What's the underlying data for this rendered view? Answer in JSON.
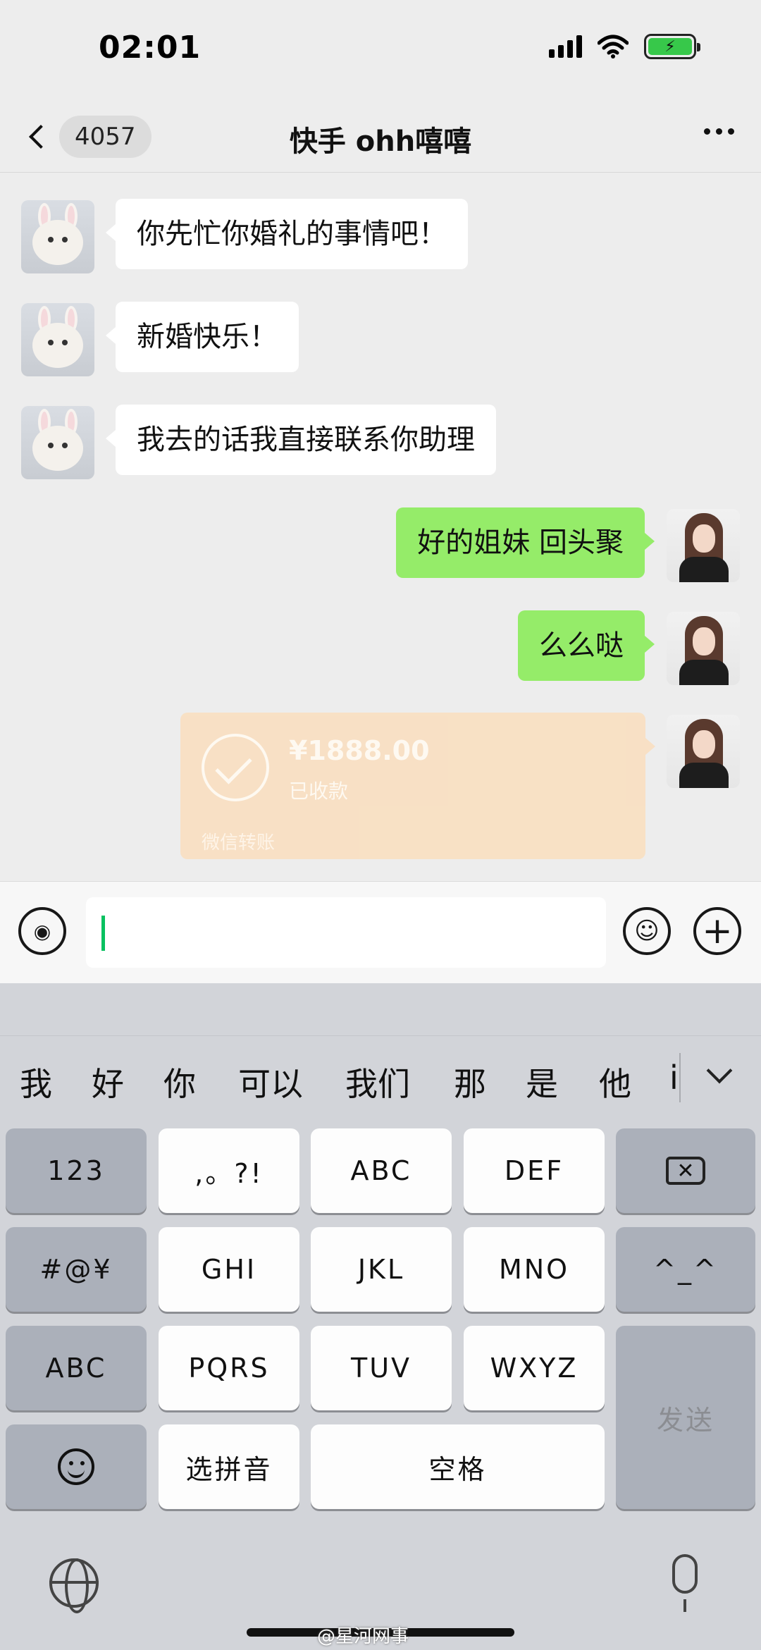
{
  "status_bar": {
    "time": "02:01",
    "battery_glyph": "⚡"
  },
  "nav": {
    "unread_count": "4057",
    "title": "快手 ohh嘻嘻"
  },
  "messages": [
    {
      "from": "other",
      "text": "你先忙你婚礼的事情吧！"
    },
    {
      "from": "other",
      "text": "新婚快乐！"
    },
    {
      "from": "other",
      "text": "我去的话我直接联系你助理"
    },
    {
      "from": "me",
      "text": "好的姐妹 回头聚"
    },
    {
      "from": "me",
      "text": "么么哒"
    }
  ],
  "transfer": {
    "amount": "¥1888.00",
    "status": "已收款",
    "label": "微信转账"
  },
  "input_bar": {
    "voice_glyph": "◉",
    "emoji_glyph": "☺",
    "plus_glyph": "+"
  },
  "keyboard": {
    "candidates": [
      "我",
      "好",
      "你",
      "可以",
      "我们",
      "那",
      "是",
      "他",
      "i"
    ],
    "keys": {
      "num": "123",
      "punct": ",。?!",
      "abc": "ABC",
      "def": "DEF",
      "symbols": "#@¥",
      "ghi": "GHI",
      "jkl": "JKL",
      "mno": "MNO",
      "emoticon": "^_^",
      "abc_mode": "ABC",
      "pqrs": "PQRS",
      "tuv": "TUV",
      "wxyz": "WXYZ",
      "send": "发送",
      "pinyin": "选拼音",
      "space": "空格",
      "delete_glyph": "✕"
    }
  },
  "watermark": "@星河网事"
}
